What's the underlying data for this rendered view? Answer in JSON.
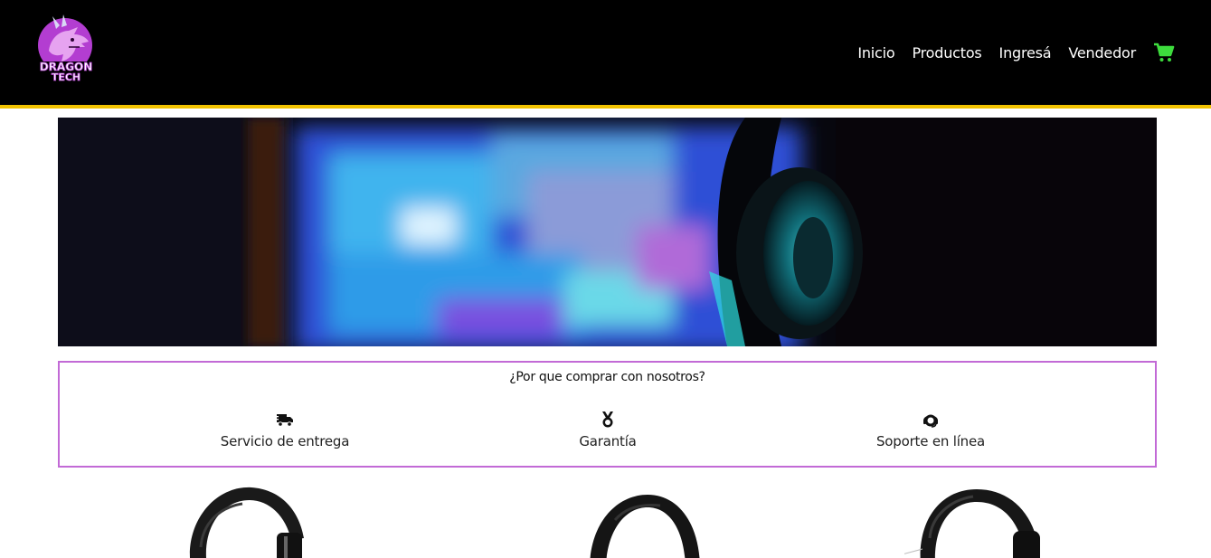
{
  "brand": {
    "logo_line1": "DRAGON",
    "logo_line2": "TECH",
    "logo_purple": "#b33dd1",
    "logo_light": "#e6a3f0"
  },
  "nav": {
    "items": [
      {
        "label": "Inicio"
      },
      {
        "label": "Productos"
      },
      {
        "label": "Ingresá"
      },
      {
        "label": "Vendedor"
      }
    ],
    "cart_icon": "shopping-cart-icon",
    "cart_color": "#3ddc3d"
  },
  "colors": {
    "header_bg": "#000000",
    "header_accent": "#f2c300",
    "why_border": "#c26ad6"
  },
  "why": {
    "title": "¿Por que comprar con nosotros?",
    "features": [
      {
        "icon": "delivery-truck-icon",
        "label": "Servicio de entrega"
      },
      {
        "icon": "medal-icon",
        "label": "Garantía"
      },
      {
        "icon": "headset-support-icon",
        "label": "Soporte en línea"
      }
    ]
  },
  "products": [
    {
      "icon": "headset-image"
    },
    {
      "icon": "headset-image"
    },
    {
      "icon": "headset-image"
    }
  ]
}
